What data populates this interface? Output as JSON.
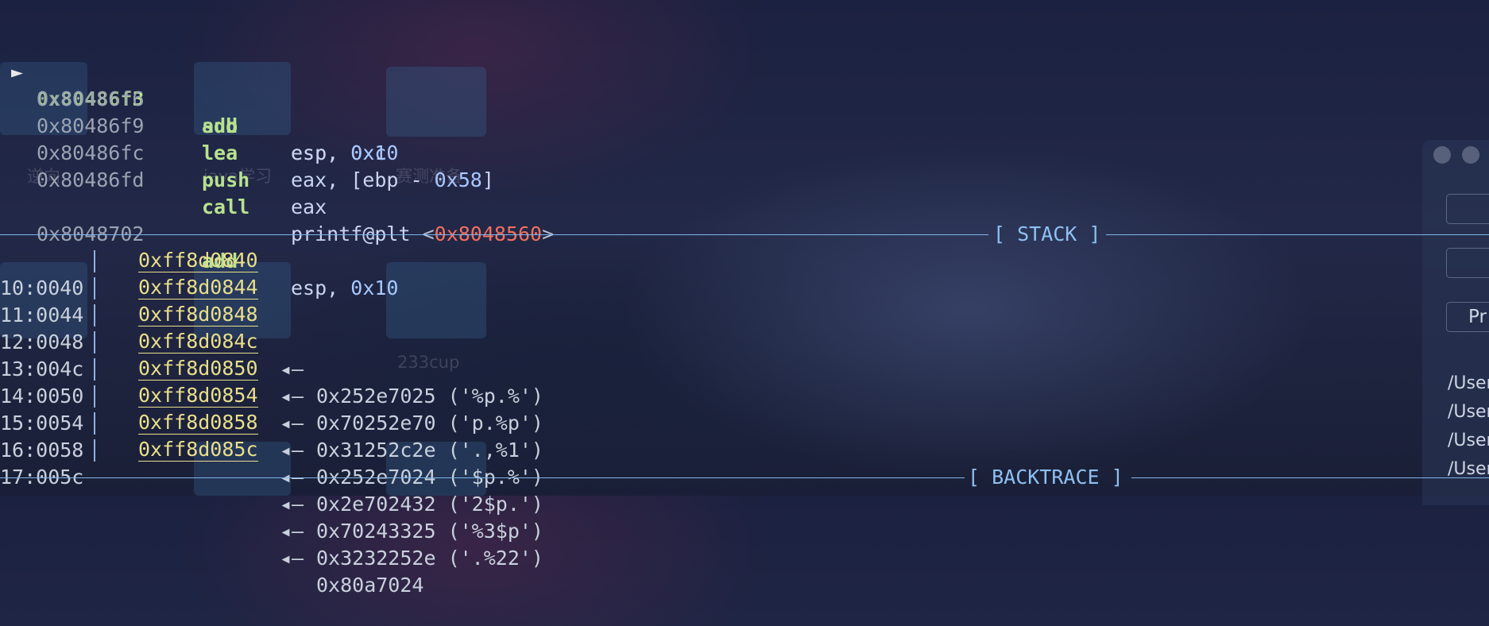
{
  "disasm": [
    {
      "arrow": "►",
      "address": "0x80486f3",
      "mnemonic": "add",
      "operand_reg": "esp, ",
      "operand_num": "0x10",
      "current": true
    },
    {
      "arrow": "",
      "address": "0x80486f6",
      "mnemonic": "sub",
      "operand_reg": "esp, ",
      "operand_num": "0xc",
      "current": false
    },
    {
      "arrow": "",
      "address": "0x80486f9",
      "mnemonic": "lea",
      "operand_reg": "eax, [ebp - ",
      "operand_num": "0x58",
      "operand_tail": "]",
      "current": false
    },
    {
      "arrow": "",
      "address": "0x80486fc",
      "mnemonic": "push",
      "operand_reg": "eax",
      "current": false
    },
    {
      "arrow": "",
      "address": "0x80486fd",
      "mnemonic": "call",
      "operand_reg": "printf@plt ",
      "open": "<",
      "target": "0x8048560",
      "close": ">",
      "current": false
    },
    {
      "arrow": "",
      "address": "0x8048702",
      "mnemonic": "add",
      "operand_reg": "esp, ",
      "operand_num": "0x10",
      "current": false
    }
  ],
  "stack_title": "[ STACK ]",
  "backtrace_title": "[ BACKTRACE ]",
  "stack": [
    {
      "offset": "10:0040",
      "address": "0xff8d0840",
      "arrow": "◂—",
      "value": "0x252e7025 ('%p.%')"
    },
    {
      "offset": "11:0044",
      "address": "0xff8d0844",
      "arrow": "◂—",
      "value": "0x70252e70 ('p.%p')"
    },
    {
      "offset": "12:0048",
      "address": "0xff8d0848",
      "arrow": "◂—",
      "value": "0x31252c2e ('.,%1')"
    },
    {
      "offset": "13:004c",
      "address": "0xff8d084c",
      "arrow": "◂—",
      "value": "0x252e7024 ('$p.%')"
    },
    {
      "offset": "14:0050",
      "address": "0xff8d0850",
      "arrow": "◂—",
      "value": "0x2e702432 ('2$p.')"
    },
    {
      "offset": "15:0054",
      "address": "0xff8d0854",
      "arrow": "◂—",
      "value": "0x70243325 ('%3$p')"
    },
    {
      "offset": "16:0058",
      "address": "0xff8d0858",
      "arrow": "◂—",
      "value": "0x3232252e ('.%22')"
    },
    {
      "offset": "17:005c",
      "address": "0xff8d085c",
      "arrow": "◂—",
      "value": "0x80a7024"
    }
  ],
  "desktop_labels": {
    "reverse": "逆向",
    "java": "java学习",
    "exam": "赛测准备",
    "cup": "233cup"
  },
  "side_panel": {
    "button_text": "Pr",
    "paths": [
      "/User",
      "/User",
      "/User",
      "/User"
    ]
  },
  "colors": {
    "accent": "#7fb4ea",
    "mnemonic": "#b7e28f",
    "stack_addr": "#e9df8a",
    "call_target": "#f27060"
  },
  "icons": {
    "current_line_marker": "right-pointer-icon",
    "stack_pointer_arrow": "left-arrow-icon"
  }
}
